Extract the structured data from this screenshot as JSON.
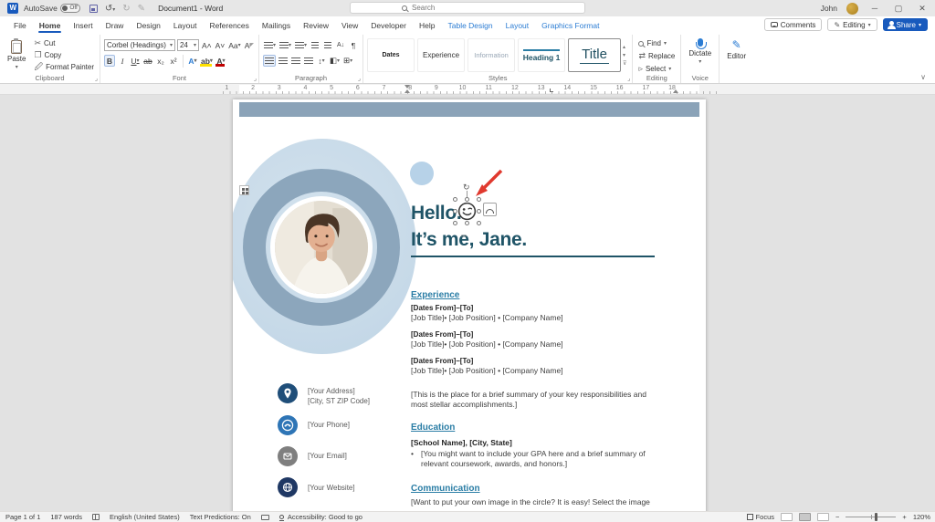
{
  "titlebar": {
    "autosave_label": "AutoSave",
    "autosave_state": "Off",
    "doc_title": "Document1 - Word",
    "search_placeholder": "Search",
    "user_name": "John"
  },
  "ribbon_tabs": [
    "File",
    "Home",
    "Insert",
    "Draw",
    "Design",
    "Layout",
    "References",
    "Mailings",
    "Review",
    "View",
    "Developer",
    "Help",
    "Table Design",
    "Layout",
    "Graphics Format"
  ],
  "top_actions": {
    "comments": "Comments",
    "editing": "Editing",
    "share": "Share"
  },
  "ribbon": {
    "clipboard": {
      "label": "Clipboard",
      "paste": "Paste",
      "cut": "Cut",
      "copy": "Copy",
      "format_painter": "Format Painter"
    },
    "font": {
      "label": "Font",
      "font_name": "Corbel (Headings)",
      "font_size": "24"
    },
    "paragraph": {
      "label": "Paragraph"
    },
    "styles": {
      "label": "Styles",
      "gallery": [
        "Dates",
        "Experience",
        "Information",
        "Heading 1",
        "Title"
      ]
    },
    "editing": {
      "label": "Editing",
      "find": "Find",
      "replace": "Replace",
      "select": "Select"
    },
    "voice": {
      "label": "Voice",
      "dictate": "Dictate"
    },
    "editor_group": {
      "editor": "Editor"
    }
  },
  "ruler": {
    "numbers": [
      "1",
      "2",
      "3",
      "4",
      "5",
      "6",
      "7",
      "8",
      "9",
      "10",
      "11",
      "12",
      "13",
      "14",
      "15",
      "16",
      "17",
      "18"
    ]
  },
  "document": {
    "heading_line1": "Hello.",
    "heading_line2": "It’s me, Jane.",
    "experience": {
      "title": "Experience",
      "entries": [
        {
          "dates": "[Dates From]–[To]",
          "role": "[Job Title]• [Job Position] • [Company Name]"
        },
        {
          "dates": "[Dates From]–[To]",
          "role": "[Job Title]• [Job Position] • [Company Name]"
        },
        {
          "dates": "[Dates From]–[To]",
          "role": "[Job Title]• [Job Position] • [Company Name]"
        }
      ],
      "summary": "[This is the place for a brief summary of your key responsibilities and most stellar accomplishments.]"
    },
    "education": {
      "title": "Education",
      "school": "[School Name], [City, State]",
      "bullet": "[You might want to include your GPA here and a brief summary of relevant coursework, awards, and honors.]"
    },
    "communication": {
      "title": "Communication",
      "body": "[Want to put your own image in the circle?  It is easy!  Select the image"
    },
    "contacts": [
      {
        "line1": "[Your Address]",
        "line2": "[City, ST ZIP Code]"
      },
      {
        "line1": "[Your Phone]"
      },
      {
        "line1": "[Your Email]"
      },
      {
        "line1": "[Your Website]"
      }
    ]
  },
  "statusbar": {
    "page": "Page 1 of 1",
    "words": "187 words",
    "language": "English (United States)",
    "predictions": "Text Predictions: On",
    "accessibility": "Accessibility: Good to go",
    "focus": "Focus",
    "zoom_level": "120%"
  },
  "colors": {
    "accent": "#185abd",
    "contextual_tab": "#2b7cd3",
    "doc_heading": "#1f5467",
    "doc_subheading": "#2a7da5",
    "band": "#8ba3b8",
    "circle_outer": "#c9dbe9",
    "circle_ring": "#8ca6bc",
    "icon_address": "#1f4e79",
    "icon_phone": "#2e75b6",
    "icon_email": "#7f7f7f",
    "icon_website": "#1f3864",
    "annotation_arrow": "#e0392e"
  }
}
